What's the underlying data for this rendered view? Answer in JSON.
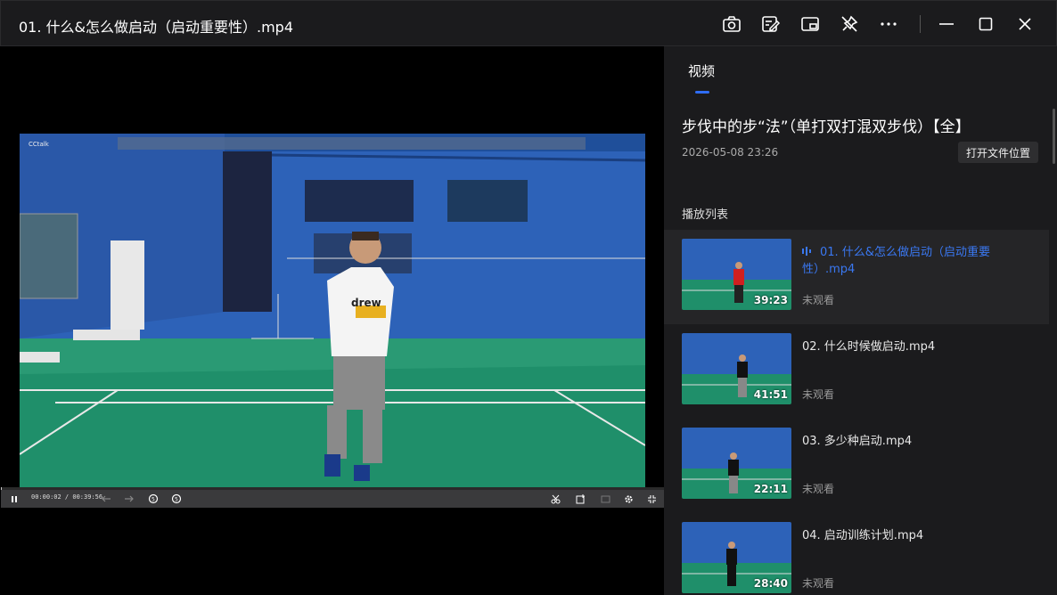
{
  "window": {
    "title": "01. 什么&怎么做启动（启动重要性）.mp4",
    "icons": [
      "camera-icon",
      "note-edit-icon",
      "picture-in-picture-icon",
      "pin-off-icon",
      "more-icon",
      "minimize-icon",
      "maximize-icon",
      "close-icon"
    ]
  },
  "player": {
    "time_current": "00:00:02",
    "time_total": "00:39:56",
    "progress": 0.001,
    "watermark": "CCtalk"
  },
  "panel": {
    "tab_label": "视频",
    "course_title": "步伐中的步“法”（单打双打混双步伐）【全】",
    "date": "2026-05-08 23:26",
    "open_location_label": "打开文件位置",
    "playlist_label": "播放列表",
    "items": [
      {
        "name": "01. 什么&怎么做启动（启动重要性）.mp4",
        "duration": "39:23",
        "status": "未观看",
        "active": true
      },
      {
        "name": "02. 什么时候做启动.mp4",
        "duration": "41:51",
        "status": "未观看",
        "active": false
      },
      {
        "name": "03. 多少种启动.mp4",
        "duration": "22:11",
        "status": "未观看",
        "active": false
      },
      {
        "name": "04. 启动训练计划.mp4",
        "duration": "28:40",
        "status": "未观看",
        "active": false
      }
    ]
  },
  "colors": {
    "accent": "#2f6df6",
    "active_text": "#3a78f2",
    "court_green": "#1f8f6a",
    "wall_blue": "#2d62b8"
  }
}
